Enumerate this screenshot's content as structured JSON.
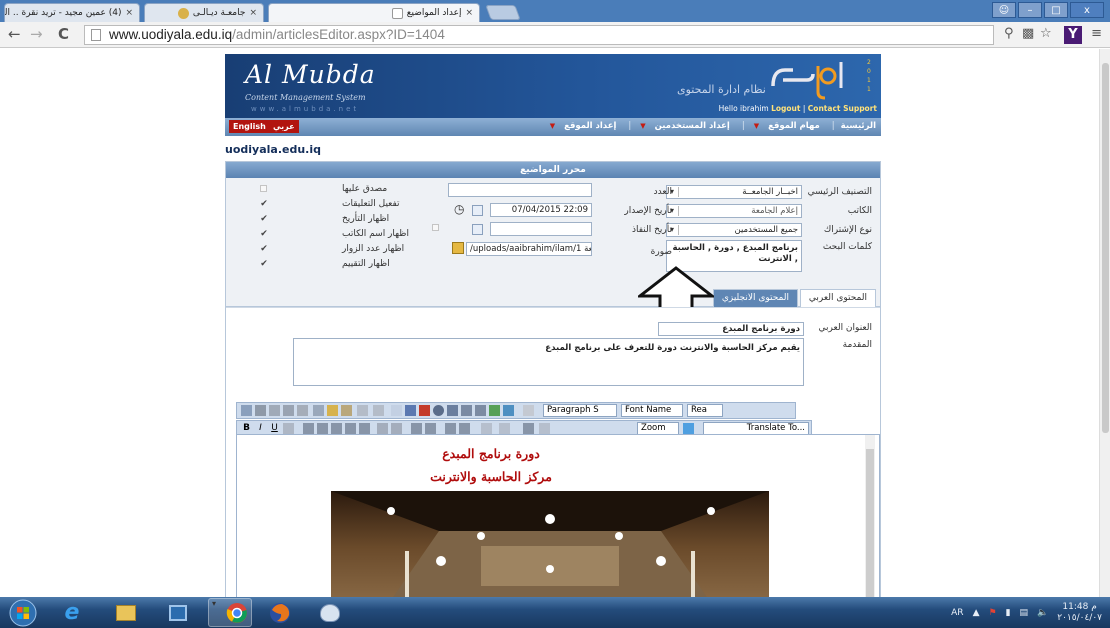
{
  "browser": {
    "tabs": [
      {
        "label": "(4) عمين مجيد - تريد نقرة .. التحة",
        "active": false
      },
      {
        "label": "جامعـة ديـالـى",
        "active": false
      },
      {
        "label": "إعداد المواضيع",
        "active": true
      }
    ],
    "url_host": "www.uodiyala.edu.iq",
    "url_path": "/admin/articlesEditor.aspx?ID=1404"
  },
  "site": {
    "brand": "Al Mubda",
    "brand_sub": "Content Management System",
    "brand_url": "www.almubda.net",
    "system_name": "نظام ادارة المحتوى",
    "hello": "Hello ibrahim",
    "logout": "Logout",
    "contact": "Contact Support",
    "lang_english": "English",
    "lang_arabic": "عربي",
    "menu": [
      "الرئيسية",
      "مهام الموقع",
      "إعداد المستخدمين",
      "إعداد الموقع"
    ],
    "domain_label": "uodiyala.edu.iq"
  },
  "form": {
    "title": "محرر المواضيع",
    "category_label": "التصنيف الرئيسي",
    "category_value": "اخبــار الجامعــة",
    "writer_label": "الكاتب",
    "writer_value": "إعلام الجامعة",
    "subscription_label": "نوع الإشتراك",
    "subscription_value": "جميع المستخدمين",
    "keywords_label": "كلمات البحث",
    "keywords_value": "برنامج المبدع , دورة , الحاسبة , الانترنت",
    "issue_label": "العدد",
    "issue_value": "",
    "date_label": "تأريخ الإصدار",
    "date_value": "22:09 07/04/2015",
    "expiry_label": "تأريخ النفاذ",
    "expiry_value": "",
    "image_label": "صورة",
    "image_value": "/uploads/aaibrahim/ilam/1 جامعة",
    "options": [
      {
        "label": "مصدق عليها",
        "checked": false
      },
      {
        "label": "تفعيل التعليقات",
        "checked": true
      },
      {
        "label": "اظهار التأريخ",
        "checked": true
      },
      {
        "label": "اظهار اسم الكاتب",
        "checked": true
      },
      {
        "label": "اظهار عدد الزوار",
        "checked": true
      },
      {
        "label": "اظهار التقييم",
        "checked": true
      }
    ],
    "tab_arabic": "المحتوى العربي",
    "tab_english": "المحتوى الانجليزي",
    "arabic_title_label": "العنوان العربي",
    "arabic_title_value": "دورة برنامج المبدع",
    "intro_label": "المقدمة",
    "intro_value": "يقيم مركز الحاسبة والانترنت دورة للتعرف على برنامج المبدع"
  },
  "editor_toolbar": {
    "paragraph": "Paragraph S",
    "font_name": "Font Name",
    "size": "Rea",
    "zoom": "Zoom",
    "translate": "Translate To..."
  },
  "editor": {
    "heading1": "دورة برنامج المبدع",
    "heading2": "مركز الحاسبة والانترنت"
  },
  "taskbar": {
    "lang": "AR",
    "time": "11:48 م",
    "date": "٢٠١٥/٠٤/٠٧"
  }
}
